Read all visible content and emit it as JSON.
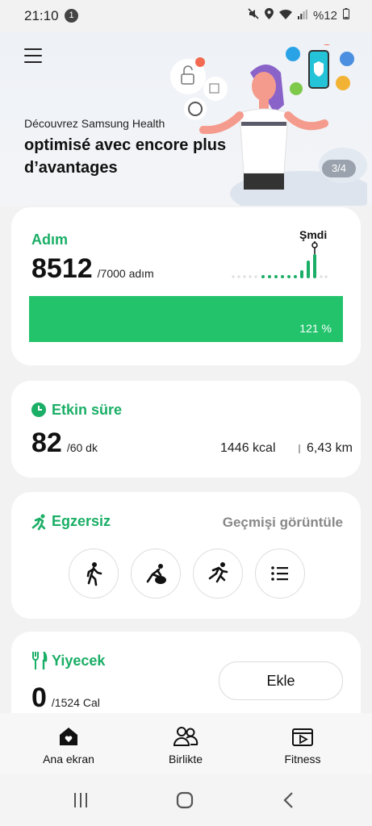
{
  "status_bar": {
    "time": "21:10",
    "notification_count": "1",
    "battery": "%12"
  },
  "banner": {
    "subtitle": "Découvrez Samsung Health",
    "title": "optimisé avec encore plus d’avantages",
    "page_indicator": "3/4"
  },
  "steps": {
    "title": "Adım",
    "value": "8512",
    "goal": "/7000 adım",
    "now_label": "Şmdi",
    "percent_label": "121 %",
    "progress": 1.21
  },
  "active_time": {
    "title": "Etkin süre",
    "value": "82",
    "goal": "/60 dk",
    "kcal": "1446 kcal",
    "distance": "6,43 km"
  },
  "exercise": {
    "title": "Egzersiz",
    "history_link": "Geçmişi görüntüle",
    "buttons": [
      "walking-icon",
      "yoga-icon",
      "running-icon",
      "list-icon"
    ]
  },
  "food": {
    "title": "Yiyecek",
    "value": "0",
    "goal": "/1524 Cal",
    "add_label": "Ekle"
  },
  "bottom_nav": {
    "items": [
      {
        "label": "Ana ekran",
        "icon": "home-icon"
      },
      {
        "label": "Birlikte",
        "icon": "people-icon"
      },
      {
        "label": "Fitness",
        "icon": "fitness-icon"
      }
    ]
  },
  "colors": {
    "accent": "#1aae66",
    "bar": "#22c36b"
  }
}
